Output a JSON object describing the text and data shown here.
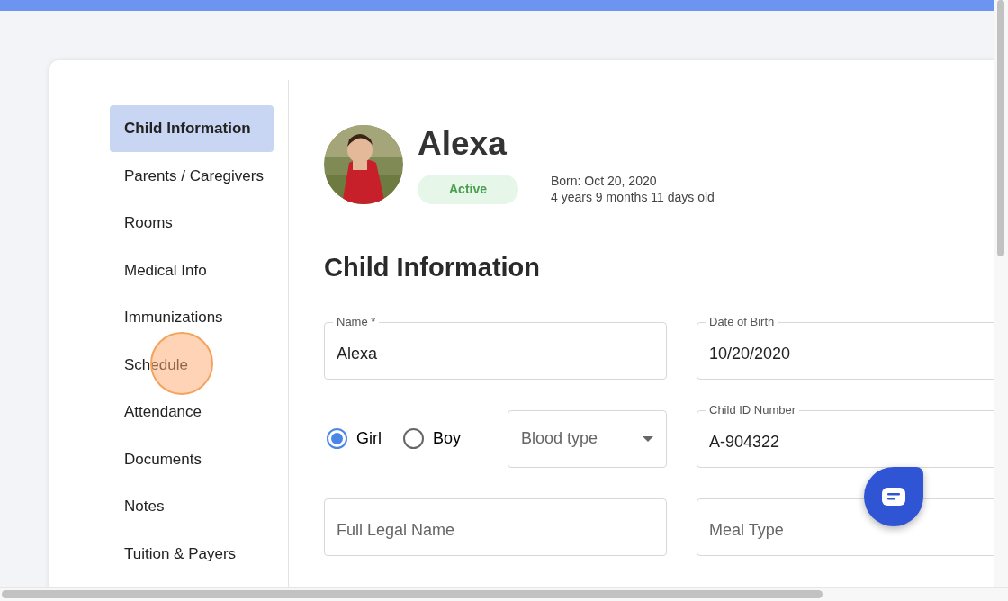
{
  "sidebar": {
    "items": [
      {
        "label": "Child Information",
        "selected": true
      },
      {
        "label": "Parents / Caregivers",
        "selected": false
      },
      {
        "label": "Rooms",
        "selected": false
      },
      {
        "label": "Medical Info",
        "selected": false
      },
      {
        "label": "Immunizations",
        "selected": false
      },
      {
        "label": "Schedule",
        "selected": false
      },
      {
        "label": "Attendance",
        "selected": false
      },
      {
        "label": "Documents",
        "selected": false
      },
      {
        "label": "Notes",
        "selected": false
      },
      {
        "label": "Tuition & Payers",
        "selected": false
      }
    ]
  },
  "profile": {
    "name": "Alexa",
    "status": "Active",
    "born": "Born: Oct 20, 2020",
    "age": "4 years 9 months 11 days old"
  },
  "section_title": "Child Information",
  "fields": [
    {
      "kind": "text",
      "label": "Name *",
      "value": "Alexa"
    },
    {
      "kind": "text",
      "label": "Date of Birth",
      "value": "10/20/2020"
    },
    {
      "kind": "gender",
      "options": [
        {
          "label": "Girl",
          "selected": true
        },
        {
          "label": "Boy",
          "selected": false
        }
      ],
      "select": {
        "placeholder": "Blood type"
      }
    },
    {
      "kind": "text",
      "label": "Child ID Number",
      "value": "A-904322"
    },
    {
      "kind": "text",
      "placeholder": "Full Legal Name"
    },
    {
      "kind": "text",
      "placeholder": "Meal Type"
    }
  ]
}
